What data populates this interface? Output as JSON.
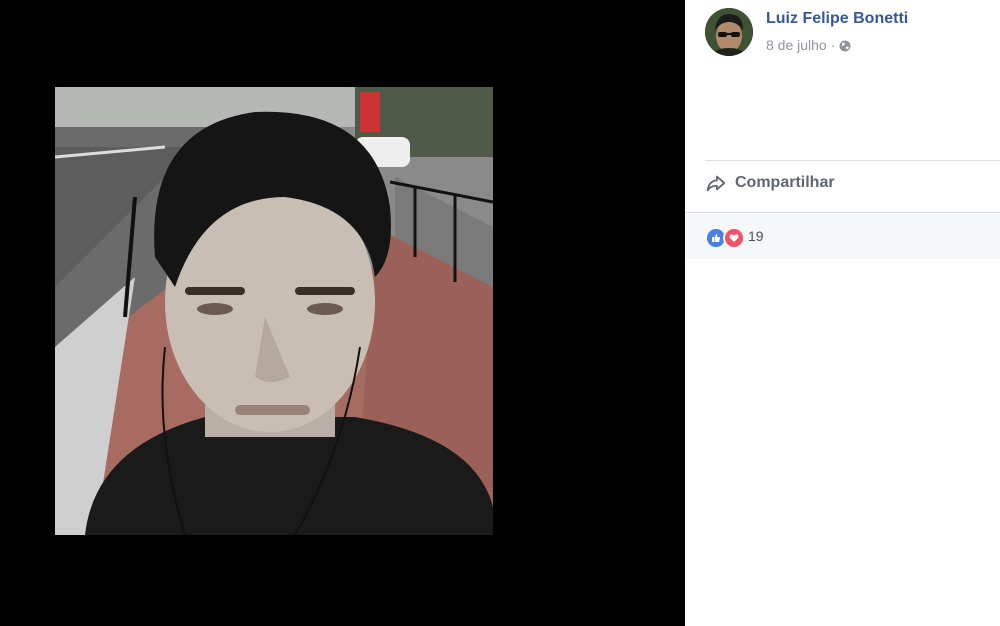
{
  "post": {
    "author_name": "Luiz Felipe Bonetti",
    "date": "8 de julho",
    "separator": "·",
    "privacy_icon": "globe-icon"
  },
  "actions": {
    "share_label": "Compartilhar",
    "share_icon": "share-arrow-icon"
  },
  "reactions": {
    "count": "19",
    "types": [
      "like-icon",
      "love-icon"
    ],
    "colors": {
      "like": "#4a7fe8",
      "love": "#f25268"
    }
  },
  "colors": {
    "viewer_background": "#000000",
    "link": "#365899",
    "meta": "#90949c"
  }
}
